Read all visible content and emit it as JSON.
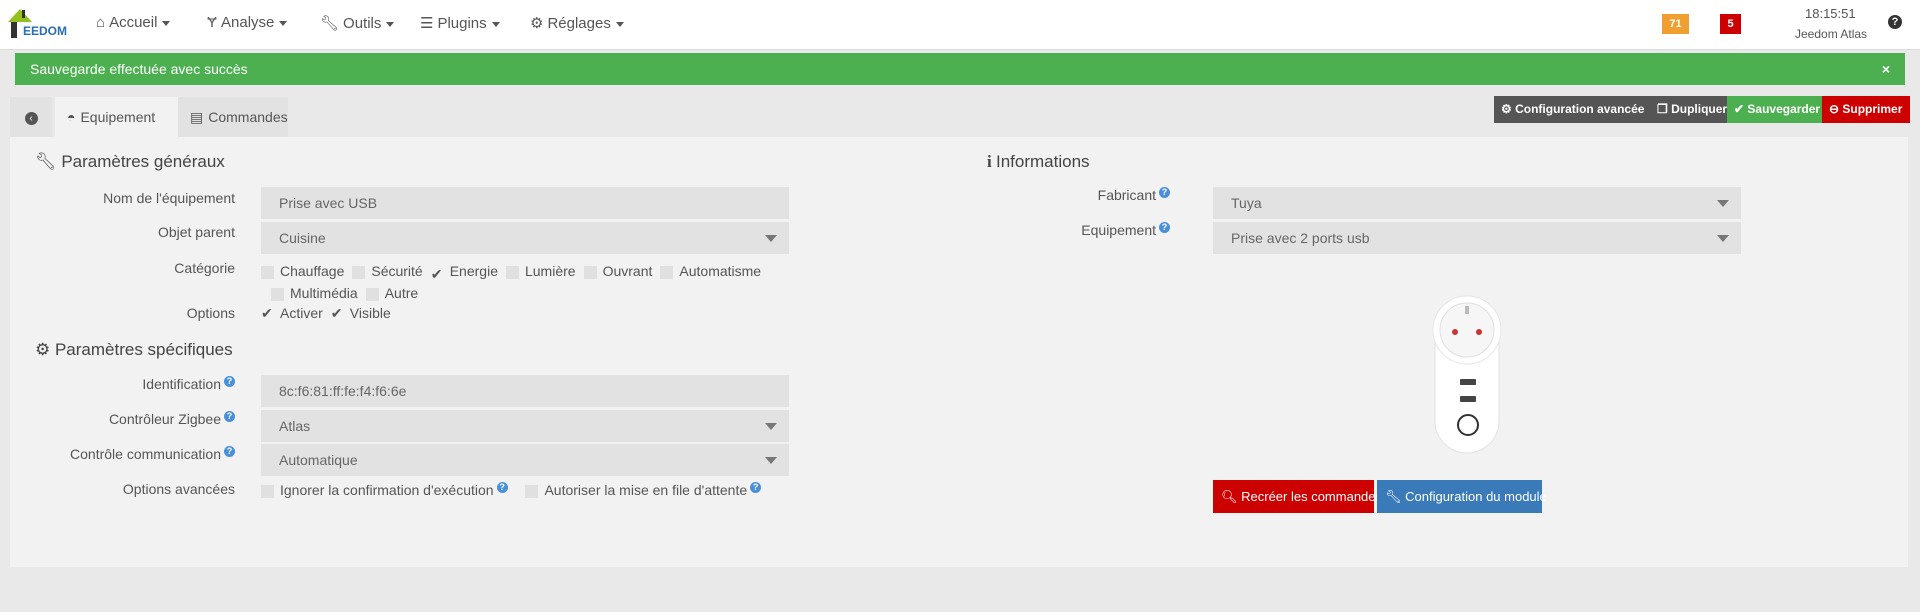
{
  "navbar": {
    "logo_text": "EEDOM",
    "items": [
      {
        "label": "Accueil",
        "icon": "home-icon"
      },
      {
        "label": "Analyse",
        "icon": "stethoscope-icon"
      },
      {
        "label": "Outils",
        "icon": "wrench-icon"
      },
      {
        "label": "Plugins",
        "icon": "list-icon"
      },
      {
        "label": "Réglages",
        "icon": "gear-icon"
      }
    ],
    "badge_orange": "71",
    "badge_red": "5",
    "time": "18:15:51",
    "system_name": "Jeedom Atlas",
    "colors": {
      "orange": "#f0a030",
      "red": "#c9302c"
    }
  },
  "alert": {
    "message": "Sauvegarde effectuée avec succès",
    "close": "×",
    "color": "#4caf50"
  },
  "tabs": [
    {
      "label": "Equipement"
    },
    {
      "label": "Commandes"
    }
  ],
  "actions": {
    "advanced": "Configuration avancée",
    "duplicate": "Dupliquer",
    "save": "Sauvegarder",
    "delete": "Supprimer"
  },
  "general": {
    "title": "Paramètres généraux",
    "name_label": "Nom de l'équipement",
    "name_value": "Prise avec USB",
    "parent_label": "Objet parent",
    "parent_value": "Cuisine",
    "category_label": "Catégorie",
    "categories": [
      {
        "label": "Chauffage",
        "checked": false
      },
      {
        "label": "Sécurité",
        "checked": false
      },
      {
        "label": "Energie",
        "checked": true
      },
      {
        "label": "Lumière",
        "checked": false
      },
      {
        "label": "Ouvrant",
        "checked": false
      },
      {
        "label": "Automatisme",
        "checked": false
      },
      {
        "label": "Multimédia",
        "checked": false
      },
      {
        "label": "Autre",
        "checked": false
      }
    ],
    "options_label": "Options",
    "options": [
      {
        "label": "Activer",
        "checked": true
      },
      {
        "label": "Visible",
        "checked": true
      }
    ]
  },
  "specific": {
    "title": "Paramètres spécifiques",
    "id_label": "Identification",
    "id_value": "8c:f6:81:ff:fe:f4:f6:6e",
    "zigbee_label": "Contrôleur Zigbee",
    "zigbee_value": "Atlas",
    "comm_label": "Contrôle communication",
    "comm_value": "Automatique",
    "adv_label": "Options avancées",
    "adv_options": [
      {
        "label": "Ignorer la confirmation d'exécution",
        "checked": false
      },
      {
        "label": "Autoriser la mise en file d'attente",
        "checked": false
      }
    ]
  },
  "info": {
    "title": "Informations",
    "maker_label": "Fabricant",
    "maker_value": "Tuya",
    "equip_label": "Equipement",
    "equip_value": "Prise avec 2 ports usb",
    "recreate": "Recréer les commandes",
    "module_config": "Configuration du module"
  }
}
